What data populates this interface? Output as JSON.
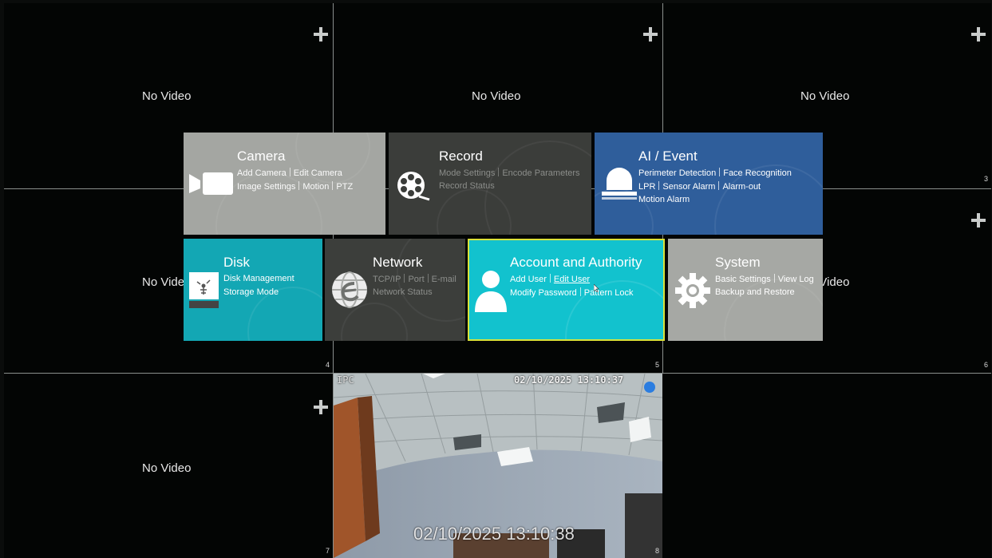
{
  "grid": {
    "no_video_label": "No Video",
    "channels": [
      "3",
      "4",
      "5",
      "6",
      "7",
      "8"
    ]
  },
  "camera_feed": {
    "source_label": "IPC",
    "osd_timestamp": "02/10/2025 13:10:37",
    "bottom_timestamp": "02/10/2025 13:10:38"
  },
  "menu": {
    "camera": {
      "title": "Camera",
      "items": [
        "Add Camera",
        "Edit Camera",
        "Image Settings",
        "Motion",
        "PTZ"
      ]
    },
    "record": {
      "title": "Record",
      "items": [
        "Mode Settings",
        "Encode Parameters",
        "Record Status"
      ]
    },
    "ai_event": {
      "title": "AI / Event",
      "items": [
        "Perimeter Detection",
        "Face Recognition",
        "LPR",
        "Sensor Alarm",
        "Alarm-out",
        "Motion Alarm"
      ]
    },
    "disk": {
      "title": "Disk",
      "items": [
        "Disk Management",
        "Storage Mode"
      ]
    },
    "network": {
      "title": "Network",
      "items": [
        "TCP/IP",
        "Port",
        "E-mail",
        "Network Status"
      ]
    },
    "account": {
      "title": "Account and Authority",
      "items": [
        "Add User",
        "Edit User",
        "Modify Password",
        "Pattern Lock"
      ]
    },
    "system": {
      "title": "System",
      "items": [
        "Basic Settings",
        "View Log",
        "Backup and Restore"
      ]
    }
  },
  "colors": {
    "camera_tile": "#a4a6a2",
    "record_tile": "#3b3d3a",
    "ai_tile": "#2f5e9b",
    "disk_tile": "#13a7b4",
    "network_tile": "#3c3e3b",
    "account_tile": "#12c2ce",
    "system_tile": "#a6a8a4",
    "highlight_border": "#d9e23a"
  }
}
